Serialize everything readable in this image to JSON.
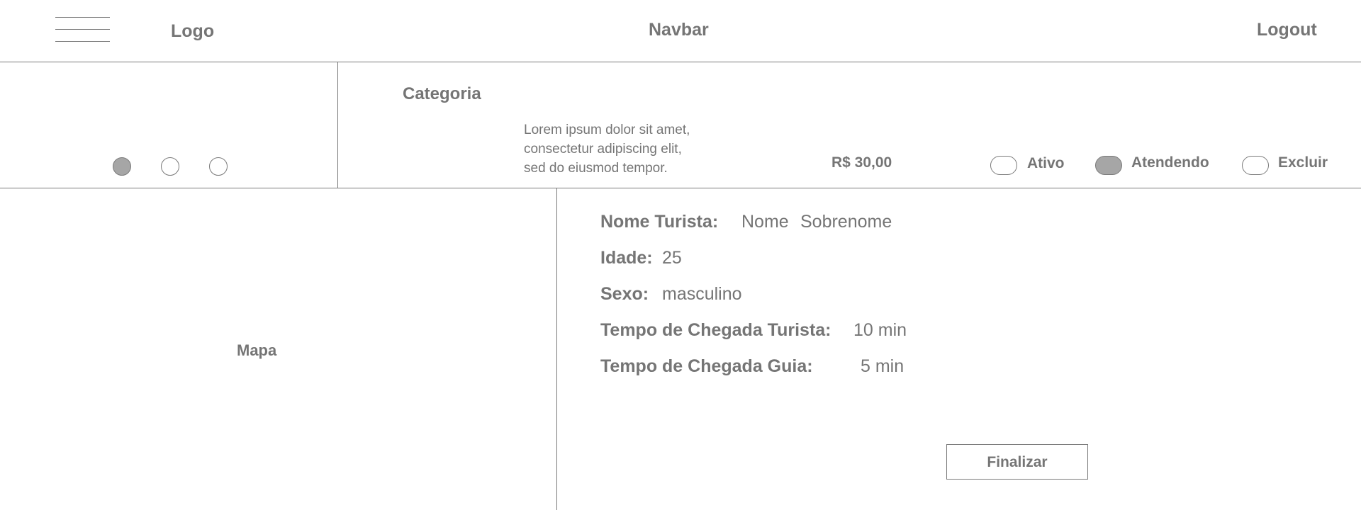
{
  "navbar": {
    "logo_label": "Logo",
    "title": "Navbar",
    "logout_label": "Logout",
    "menu_icon": "hamburger-menu-icon"
  },
  "carousel": {
    "dots": [
      {
        "active": true
      },
      {
        "active": false
      },
      {
        "active": false
      }
    ]
  },
  "service": {
    "category_label": "Categoria",
    "description_lines": [
      "Lorem ipsum dolor sit amet,",
      "consectetur adipiscing elit,",
      "sed do eiusmod tempor."
    ],
    "price": "R$ 30,00",
    "status_options": [
      {
        "label": "Ativo",
        "on": false
      },
      {
        "label": "Atendendo",
        "on": true
      },
      {
        "label": "Excluir",
        "on": false
      }
    ]
  },
  "map": {
    "label": "Mapa"
  },
  "tourist": {
    "name_label": "Nome Turista:",
    "first_name": "Nome",
    "last_name": "Sobrenome",
    "age_label": "Idade:",
    "age_value": "25",
    "sex_label": "Sexo:",
    "sex_value": "masculino",
    "tourist_arrival_label": "Tempo de Chegada Turista:",
    "tourist_arrival_value": "10 min",
    "guide_arrival_label": "Tempo de Chegada Guia:",
    "guide_arrival_value": "5 min"
  },
  "actions": {
    "finalize_label": "Finalizar"
  },
  "colors": {
    "text": "#757575",
    "line": "#7a7a7a",
    "fill_active": "#a6a6a6",
    "background": "#ffffff"
  }
}
